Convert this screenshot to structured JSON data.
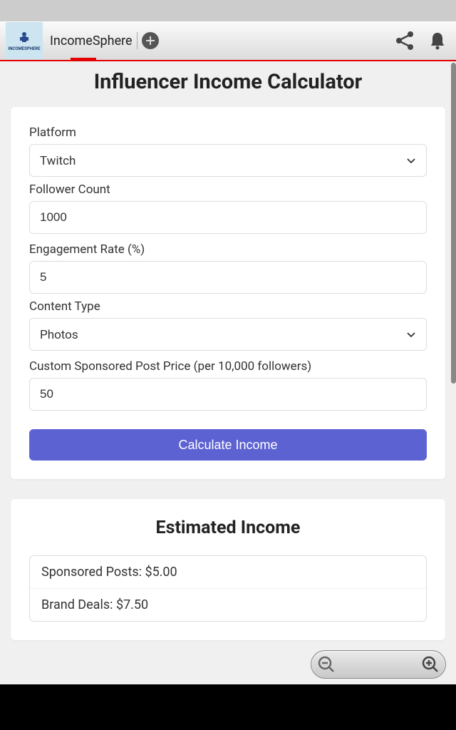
{
  "header": {
    "app_name": "IncomeSphere"
  },
  "page_title": "Influencer Income Calculator",
  "form": {
    "platform_label": "Platform",
    "platform_value": "Twitch",
    "follower_label": "Follower Count",
    "follower_value": "1000",
    "engagement_label": "Engagement Rate (%)",
    "engagement_value": "5",
    "content_type_label": "Content Type",
    "content_type_value": "Photos",
    "custom_price_label": "Custom Sponsored Post Price (per 10,000 followers)",
    "custom_price_value": "50",
    "calculate_label": "Calculate Income"
  },
  "results": {
    "title": "Estimated Income",
    "items": [
      "Sponsored Posts: $5.00",
      "Brand Deals: $7.50"
    ]
  }
}
